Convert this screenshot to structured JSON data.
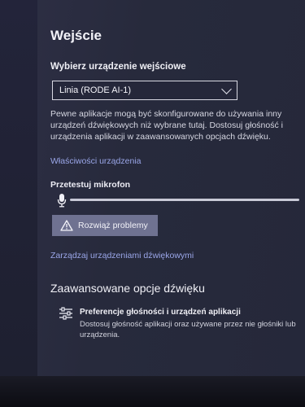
{
  "section": {
    "title": "Wejście"
  },
  "device": {
    "label": "Wybierz urządzenie wejściowe",
    "selected": "Linia (RODE AI-1)"
  },
  "description": {
    "line1": "Pewne aplikacje mogą być skonfigurowane do używania inny",
    "line2": "urządzeń dźwiękowych niż wybrane tutaj. Dostosuj głośność i",
    "line3": "urządzenia aplikacji w zaawansowanych opcjach dźwięku."
  },
  "links": {
    "device_properties": "Właściwości urządzenia",
    "manage_devices": "Zarządzaj urządzeniami dźwiękowymi"
  },
  "mic_test": {
    "label": "Przetestuj mikrofon",
    "level": 0
  },
  "troubleshoot": {
    "label": "Rozwiąż problemy"
  },
  "advanced": {
    "title": "Zaawansowane opcje dźwięku",
    "pref_title": "Preferencje głośności i urządzeń aplikacji",
    "pref_desc_line1": "Dostosuj głośność aplikacji oraz używane przez nie głośniki lub",
    "pref_desc_line2": "urządzenia."
  },
  "icons": {
    "microphone": "microphone-icon",
    "warning": "warning-icon",
    "chevron": "chevron-down-icon",
    "sliders": "sliders-icon"
  },
  "colors": {
    "background": "#272a3c",
    "link": "#9aa6e8",
    "button": "#6f7291"
  }
}
